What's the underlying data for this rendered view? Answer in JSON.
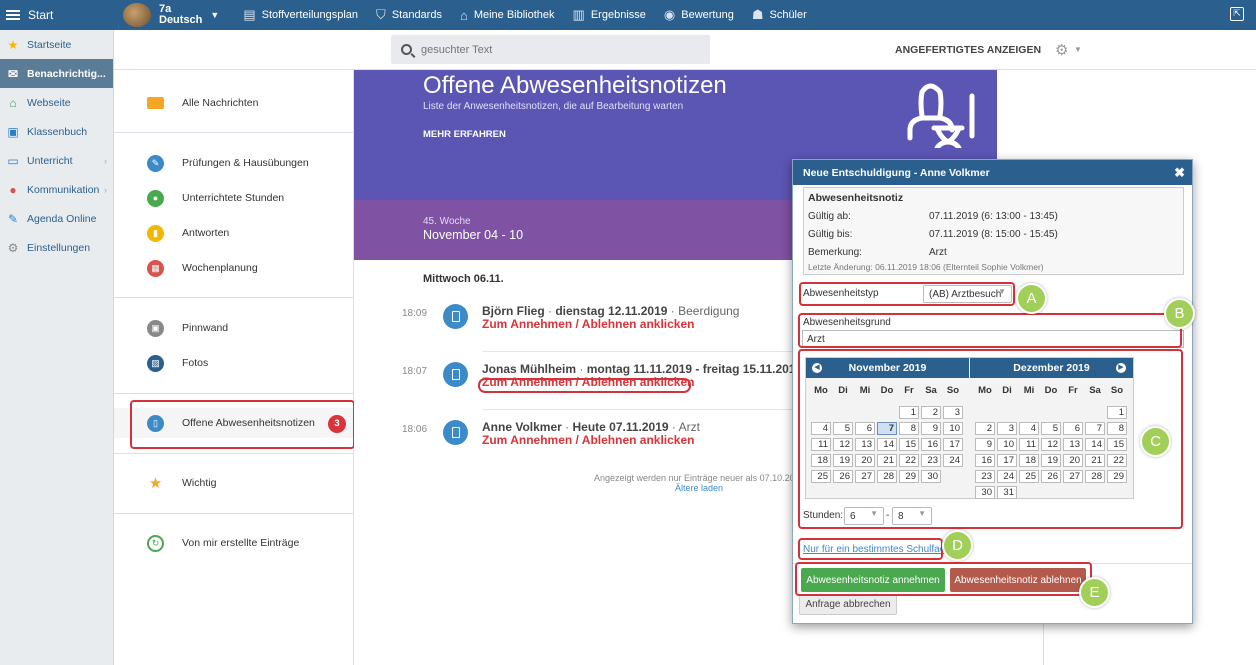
{
  "topbar": {
    "start_label": "Start",
    "class_name": "7a",
    "class_subject": "Deutsch",
    "nav": [
      {
        "label": "Stoffverteilungsplan",
        "icon": "table-icon"
      },
      {
        "label": "Standards",
        "icon": "shield-icon"
      },
      {
        "label": "Meine Bibliothek",
        "icon": "library-icon"
      },
      {
        "label": "Ergebnisse",
        "icon": "bar-chart-icon"
      },
      {
        "label": "Bewertung",
        "icon": "rating-icon"
      },
      {
        "label": "Schüler",
        "icon": "students-icon"
      }
    ]
  },
  "sidebar": {
    "items": [
      {
        "label": "Startseite",
        "icon": "star-icon"
      },
      {
        "label": "Benachrichtig...",
        "icon": "mail-icon",
        "active": true
      },
      {
        "label": "Webseite",
        "icon": "home-icon"
      },
      {
        "label": "Klassenbuch",
        "icon": "book-icon"
      },
      {
        "label": "Unterricht",
        "icon": "classroom-icon"
      },
      {
        "label": "Kommunikation",
        "icon": "chat-icon"
      },
      {
        "label": "Agenda Online",
        "icon": "pen-icon"
      },
      {
        "label": "Einstellungen",
        "icon": "gear-icon"
      }
    ]
  },
  "search": {
    "placeholder": "gesuchter Text"
  },
  "header": {
    "show_done": "ANGEFERTIGTES ANZEIGEN"
  },
  "folders": [
    {
      "label": "Alle Nachrichten",
      "icon": "envelope-icon",
      "color": "#f5a623"
    },
    {
      "label": "Prüfungen & Hausübungen",
      "icon": "exam-icon",
      "color": "#3d8ac9"
    },
    {
      "label": "Unterrichtete Stunden",
      "icon": "person-icon",
      "color": "#4aa84f"
    },
    {
      "label": "Antworten",
      "icon": "answers-icon",
      "color": "#f5b800"
    },
    {
      "label": "Wochenplanung",
      "icon": "calendar-icon",
      "color": "#d9534f"
    },
    {
      "label": "Pinnwand",
      "icon": "pinboard-icon",
      "color": "#888888"
    },
    {
      "label": "Fotos",
      "icon": "photo-icon",
      "color": "#2b5f8e"
    },
    {
      "label": "Offene Abwesenheitsnotizen",
      "icon": "absence-icon",
      "color": "#3d8ac9",
      "badge": "3"
    },
    {
      "label": "Wichtig",
      "icon": "star-icon",
      "color": "#f5a623"
    },
    {
      "label": "Von mir erstellte Einträge",
      "icon": "history-icon",
      "color": "#4aa84f"
    }
  ],
  "hero": {
    "title": "Offene Abwesenheitsnotizen",
    "subtitle": "Liste der Anwesenheitsnotizen, die auf Bearbeitung warten",
    "more": "MEHR ERFAHREN"
  },
  "week": {
    "label": "45. Woche",
    "range": "November 04 - 10"
  },
  "day_header": "Mittwoch 06.11.",
  "entries": [
    {
      "time": "18:09",
      "name": "Björn Flieg",
      "date": "dienstag 12.11.2019",
      "reason": "Beerdigung",
      "link": "Zum Annehmen / Ablehnen anklicken"
    },
    {
      "time": "18:07",
      "name": "Jonas Mühlheim",
      "date": "montag 11.11.2019 - freitag 15.11.2019",
      "reason": "",
      "link": "Zum Annehmen / Ablehnen anklicken"
    },
    {
      "time": "18:06",
      "name": "Anne Volkmer",
      "date": "Heute 07.11.2019",
      "reason": "Arzt",
      "link": "Zum Annehmen / Ablehnen anklicken"
    }
  ],
  "footnote": "Angezeigt werden nur Einträge neuer als 07.10.20",
  "load_more": "Ältere laden",
  "modal": {
    "title": "Neue Entschuldigung - Anne Volkmer",
    "notiz_header": "Abwesenheitsnotiz",
    "valid_from_label": "Gültig ab:",
    "valid_from": "07.11.2019 (6: 13:00 - 13:45)",
    "valid_to_label": "Gültig bis:",
    "valid_to": "07.11.2019 (8: 15:00 - 15:45)",
    "remark_label": "Bemerkung:",
    "remark": "Arzt",
    "last_change": "Letzte Änderung: 06.11.2019 18:06 (Elternteil Sophie Volkmer)",
    "type_label": "Abwesenheitstyp",
    "type_value": "(AB) Arztbesuch",
    "reason_label": "Abwesenheitsgrund",
    "reason_value": "Arzt",
    "month1": "November 2019",
    "month2": "Dezember 2019",
    "weekdays": [
      "Mo",
      "Di",
      "Mi",
      "Do",
      "Fr",
      "Sa",
      "So"
    ],
    "stunden_label": "Stunden:",
    "stunden_from": "6",
    "stunden_sep": "-",
    "stunden_to": "8",
    "subject_link": "Nur für ein bestimmtes Schulfach",
    "accept": "Abwesenheitsnotiz annehmen",
    "reject": "Abwesenheitsnotiz ablehnen",
    "cancel": "Anfrage abbrechen"
  },
  "callouts": [
    "A",
    "B",
    "C",
    "D",
    "E"
  ],
  "colors": {
    "topbar": "#2b5f8e",
    "hero": "#5b55b4",
    "week": "#7f52a4",
    "accept": "#4aa84f",
    "reject": "#b35a4c",
    "link": "#d9343a",
    "callout": "#a2cf59"
  }
}
